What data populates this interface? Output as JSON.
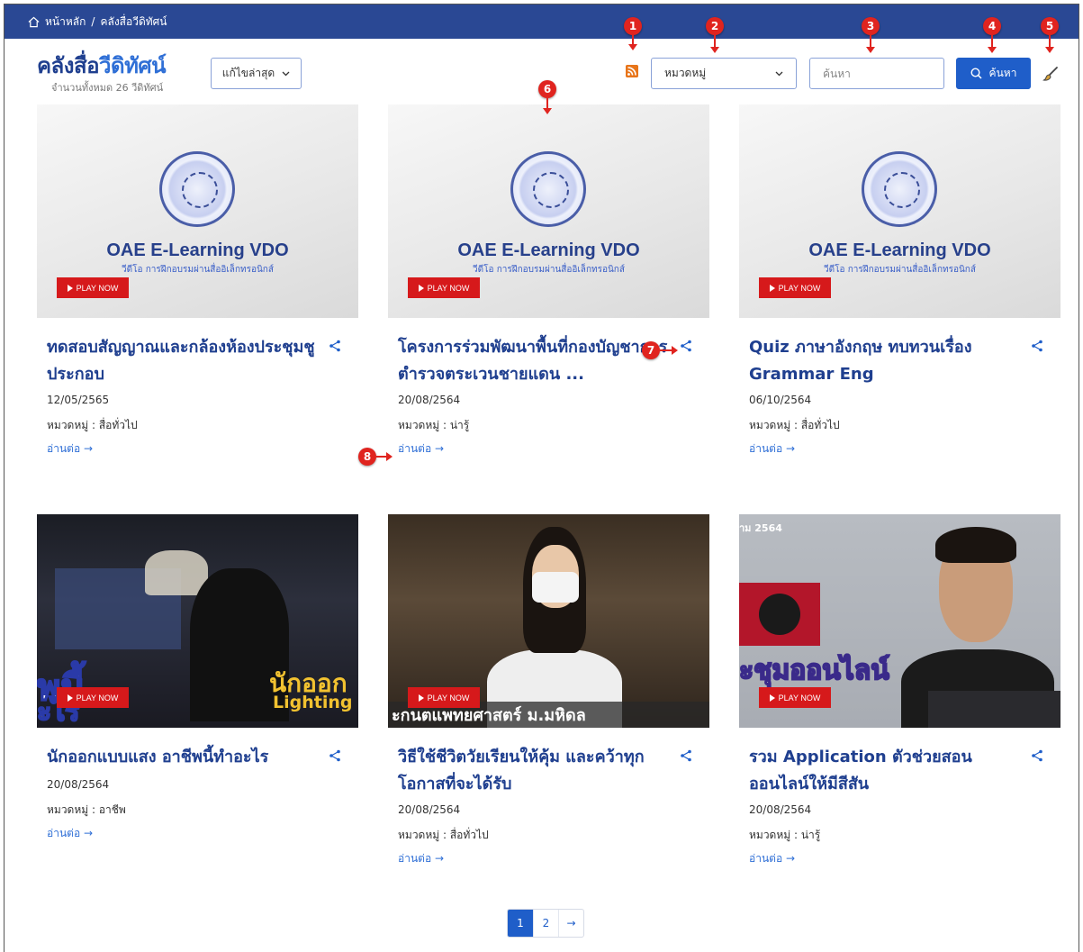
{
  "breadcrumb": {
    "home": "หน้าหลัก",
    "separator": "/",
    "current": "คลังสื่อวีดิทัศน์"
  },
  "header": {
    "title_main": "คลังสื่อ",
    "title_accent": "วีดิทัศน์",
    "count_text": "จำนวนทั้งหมด 26 วีดิทัศน์",
    "sort_label": "แก้ไขล่าสุด",
    "category_placeholder": "หมวดหมู่",
    "search_placeholder": "ค้นหา",
    "search_button": "ค้นหา"
  },
  "markers": [
    "1",
    "2",
    "3",
    "4",
    "5",
    "6",
    "7",
    "8"
  ],
  "thumb_text": {
    "oae_title": "OAE E-Learning VDO",
    "oae_sub": "วีดีโอ การฝึกอบรมผ่านสื่ออิเล็กทรอนิกส์",
    "play": "PLAY NOW"
  },
  "cards": [
    {
      "title": "ทดสอบสัญญาณและกล้องห้องประชุมชูประกอบ",
      "date": "12/05/2565",
      "category": "หมวดหมู่ : สื่อทั่วไป",
      "read_more": "อ่านต่อ →"
    },
    {
      "title": "โครงการร่วมพัฒนาพื้นที่กองบัญชาการตำรวจตระเวนชายแดน ...",
      "date": "20/08/2564",
      "category": "หมวดหมู่ : น่ารู้",
      "read_more": "อ่านต่อ →"
    },
    {
      "title": "Quiz ภาษาอังกฤษ ทบทวนเรื่อง Grammar Eng",
      "date": "06/10/2564",
      "category": "หมวดหมู่ : สื่อทั่วไป",
      "read_more": "อ่านต่อ →"
    },
    {
      "title": "นักออกแบบแสง อาชีพนี้ทำอะไร",
      "date": "20/08/2564",
      "category": "หมวดหมู่ : อาชีพ",
      "read_more": "อ่านต่อ →",
      "overlay1": "นักออก",
      "overlay2": "Lighting",
      "overlay3": "พนี้",
      "overlay4": "ะไร"
    },
    {
      "title": "วิธีใช้ชีวิตวัยเรียนให้คุ้ม และคว้าทุกโอกาสที่จะได้รับ",
      "date": "20/08/2564",
      "category": "หมวดหมู่ : สื่อทั่วไป",
      "read_more": "อ่านต่อ →",
      "overlay1": "ะกนตแพทยศาสตร์ ม.มหิดล"
    },
    {
      "title": "รวม Application ตัวช่วยสอนออนไลน์ให้มีสีสัน",
      "date": "20/08/2564",
      "category": "หมวดหมู่ : น่ารู้",
      "read_more": "อ่านต่อ →",
      "overlay1": "ะชุมออนไลน์",
      "overlay2": "าม 2564"
    }
  ],
  "pagination": {
    "page1": "1",
    "page2": "2",
    "next": "→"
  }
}
